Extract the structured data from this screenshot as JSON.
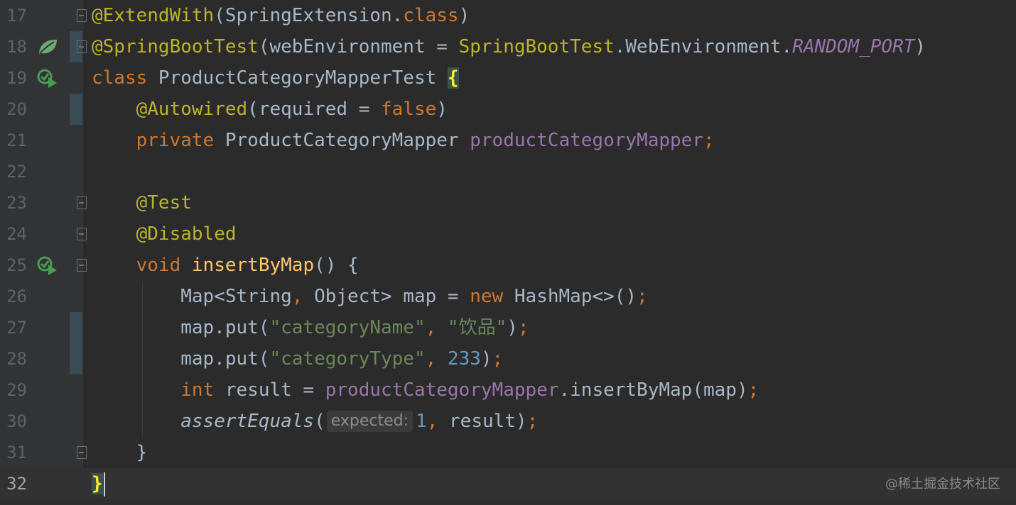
{
  "editor": {
    "language": "Java",
    "watermark": "@稀土掘金技术社区",
    "lines": [
      {
        "n": "17",
        "text": "@ExtendWith(SpringExtension.class)"
      },
      {
        "n": "18",
        "text": "@SpringBootTest(webEnvironment = SpringBootTest.WebEnvironment.RANDOM_PORT)"
      },
      {
        "n": "19",
        "text": "class ProductCategoryMapperTest {"
      },
      {
        "n": "20",
        "text": "    @Autowired(required = false)"
      },
      {
        "n": "21",
        "text": "    private ProductCategoryMapper productCategoryMapper;"
      },
      {
        "n": "22",
        "text": ""
      },
      {
        "n": "23",
        "text": "    @Test"
      },
      {
        "n": "24",
        "text": "    @Disabled"
      },
      {
        "n": "25",
        "text": "    void insertByMap() {"
      },
      {
        "n": "26",
        "text": "        Map<String, Object> map = new HashMap<>();"
      },
      {
        "n": "27",
        "text": "        map.put(\"categoryName\", \"饮品\");"
      },
      {
        "n": "28",
        "text": "        map.put(\"categoryType\", 233);"
      },
      {
        "n": "29",
        "text": "        int result = productCategoryMapper.insertByMap(map);"
      },
      {
        "n": "30",
        "text": "        assertEquals( expected: 1, result);"
      },
      {
        "n": "31",
        "text": "    }"
      },
      {
        "n": "32",
        "text": "}"
      }
    ],
    "tokens": {
      "l17": [
        "@ExtendWith",
        "(SpringExtension.",
        "class",
        ")"
      ],
      "l18": [
        "@SpringBootTest",
        "(webEnvironment = ",
        "SpringBootTest",
        ".WebEnvironment.",
        "RANDOM_PORT",
        ")"
      ],
      "l19": [
        "class",
        " ProductCategoryMapperTest ",
        "{"
      ],
      "l20": [
        "    ",
        "@Autowired",
        "(required = ",
        "false",
        ")"
      ],
      "l21": [
        "    ",
        "private",
        " ProductCategoryMapper ",
        "productCategoryMapper",
        ";"
      ],
      "l23": [
        "    ",
        "@Test"
      ],
      "l24": [
        "    ",
        "@Disabled"
      ],
      "l25": [
        "    ",
        "void",
        " ",
        "insertByMap",
        "() {"
      ],
      "l26": [
        "        Map<String",
        ",",
        " Object> map = ",
        "new",
        " HashMap<>()",
        ";"
      ],
      "l27": [
        "        map.put(",
        "\"categoryName\"",
        ",",
        " ",
        "\"饮品\"",
        ")",
        ";"
      ],
      "l28": [
        "        map.put(",
        "\"categoryType\"",
        ",",
        " ",
        "233",
        ")",
        ";"
      ],
      "l29": [
        "        ",
        "int",
        " result = ",
        "productCategoryMapper",
        ".insertByMap(map)",
        ";"
      ],
      "l30": [
        "        ",
        "assertEquals",
        "(",
        "expected:",
        "1",
        ",",
        " result)",
        ";"
      ],
      "l31": [
        "    }"
      ],
      "l32": [
        "}"
      ]
    },
    "gutter_icons": {
      "l18": "spring-bean-icon",
      "l19": "run-test-icon",
      "l25": "run-test-icon"
    },
    "current_line": "32"
  },
  "colors": {
    "background": "#2b2b2b",
    "gutter": "#313335",
    "keyword": "#cc7832",
    "annotation": "#bbb529",
    "string": "#6a8759",
    "number": "#6897bb",
    "field": "#9876aa",
    "method_decl": "#ffc66d",
    "text": "#a9b7c6",
    "run_icon": "#499c54"
  }
}
